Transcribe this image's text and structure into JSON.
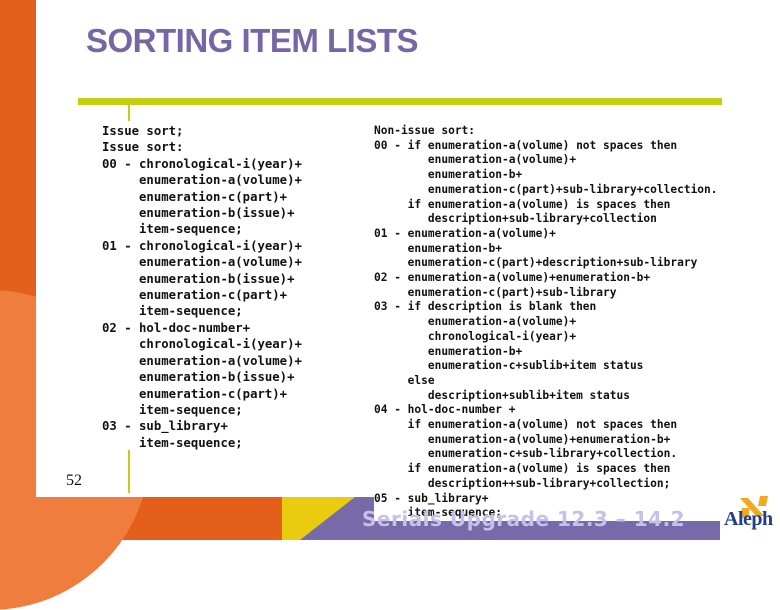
{
  "slide": {
    "title": "SORTING ITEM LISTS",
    "page_number": "52",
    "footer_title": "Serials Upgrade 12.3 – 14.2",
    "logo_text": "Aleph"
  },
  "issue_sort": {
    "lines": [
      "Issue sort;",
      "Issue sort:",
      "00 - chronological-i(year)+",
      "     enumeration-a(volume)+",
      "     enumeration-c(part)+",
      "     enumeration-b(issue)+",
      "     item-sequence;",
      "01 - chronological-i(year)+",
      "     enumeration-a(volume)+",
      "     enumeration-b(issue)+",
      "     enumeration-c(part)+",
      "     item-sequence;",
      "02 - hol-doc-number+",
      "     chronological-i(year)+",
      "     enumeration-a(volume)+",
      "     enumeration-b(issue)+",
      "     enumeration-c(part)+",
      "     item-sequence;",
      "03 - sub_library+",
      "     item-sequence;"
    ]
  },
  "non_issue_sort": {
    "lines": [
      "Non-issue sort:",
      "00 - if enumeration-a(volume) not spaces then",
      "        enumeration-a(volume)+",
      "        enumeration-b+",
      "        enumeration-c(part)+sub-library+collection.",
      "     if enumeration-a(volume) is spaces then",
      "        description+sub-library+collection",
      "01 - enumeration-a(volume)+",
      "     enumeration-b+",
      "     enumeration-c(part)+description+sub-library",
      "02 - enumeration-a(volume)+enumeration-b+",
      "     enumeration-c(part)+sub-library",
      "03 - if description is blank then",
      "        enumeration-a(volume)+",
      "        chronological-i(year)+",
      "        enumeration-b+",
      "        enumeration-c+sublib+item status",
      "     else",
      "        description+sublib+item status",
      "04 - hol-doc-number +",
      "     if enumeration-a(volume) not spaces then",
      "        enumeration-a(volume)+enumeration-b+",
      "        enumeration-c+sub-library+collection.",
      "     if enumeration-a(volume) is spaces then",
      "        description++sub-library+collection;",
      "05 - sub_library+",
      "     item-sequence;"
    ]
  },
  "colors": {
    "title": "#7766a5",
    "rule": "#c8cc14",
    "orange": "#e4601a",
    "purple": "#776aa8",
    "yellow": "#e9cb10"
  }
}
